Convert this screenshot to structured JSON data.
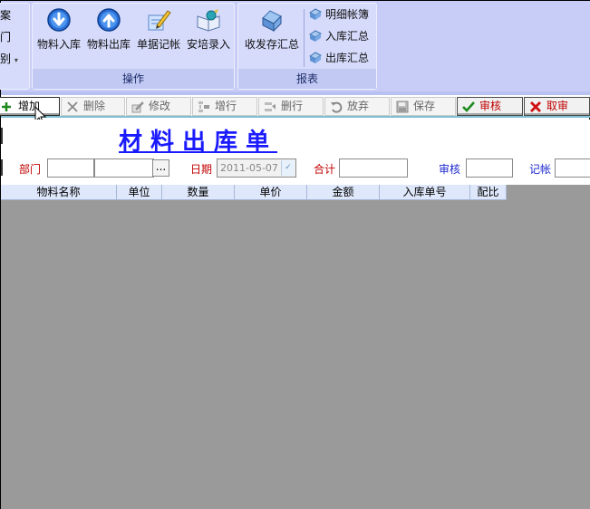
{
  "ribbon": {
    "left_cut": {
      "items": [
        "案",
        "门",
        "别"
      ]
    },
    "operations": {
      "label": "操作",
      "buttons": [
        {
          "label": "物料入库",
          "icon": "arrow-down-circle-icon"
        },
        {
          "label": "物料出库",
          "icon": "arrow-up-circle-icon"
        },
        {
          "label": "单据记帐",
          "icon": "pencil-document-icon"
        },
        {
          "label": "安培录入",
          "icon": "open-book-icon"
        }
      ]
    },
    "reports": {
      "label": "报表",
      "big_button": {
        "label": "收发存汇总",
        "icon": "folder-icon"
      },
      "small_buttons": [
        {
          "label": "明细帐簿",
          "icon": "report-icon"
        },
        {
          "label": "入库汇总",
          "icon": "report-icon"
        },
        {
          "label": "出库汇总",
          "icon": "report-icon"
        }
      ]
    }
  },
  "toolbar": {
    "add": "增加",
    "delete": "删除",
    "modify": "修改",
    "insert_row": "增行",
    "delete_row": "删行",
    "abandon": "放弃",
    "save": "保存",
    "approve": "审核",
    "unapprove": "取审"
  },
  "form": {
    "title": "材料出库单",
    "department_label": "部门",
    "department_value": "",
    "department_name_value": "",
    "browse_button": "...",
    "date_label": "日期",
    "date_value": "2011-05-07",
    "total_label": "合计",
    "total_value": "",
    "approve_label": "审核",
    "approve_value": "",
    "post_label": "记帐",
    "post_value": ""
  },
  "grid": {
    "columns": [
      "物料名称",
      "单位",
      "数量",
      "单价",
      "金额",
      "入库单号",
      "配比"
    ],
    "rows": []
  },
  "colors": {
    "ribbon_bg": "#c7cdf7",
    "title_blue": "#1a1aff",
    "danger_red": "#c00000",
    "grid_empty_bg": "#9a9a9a"
  }
}
